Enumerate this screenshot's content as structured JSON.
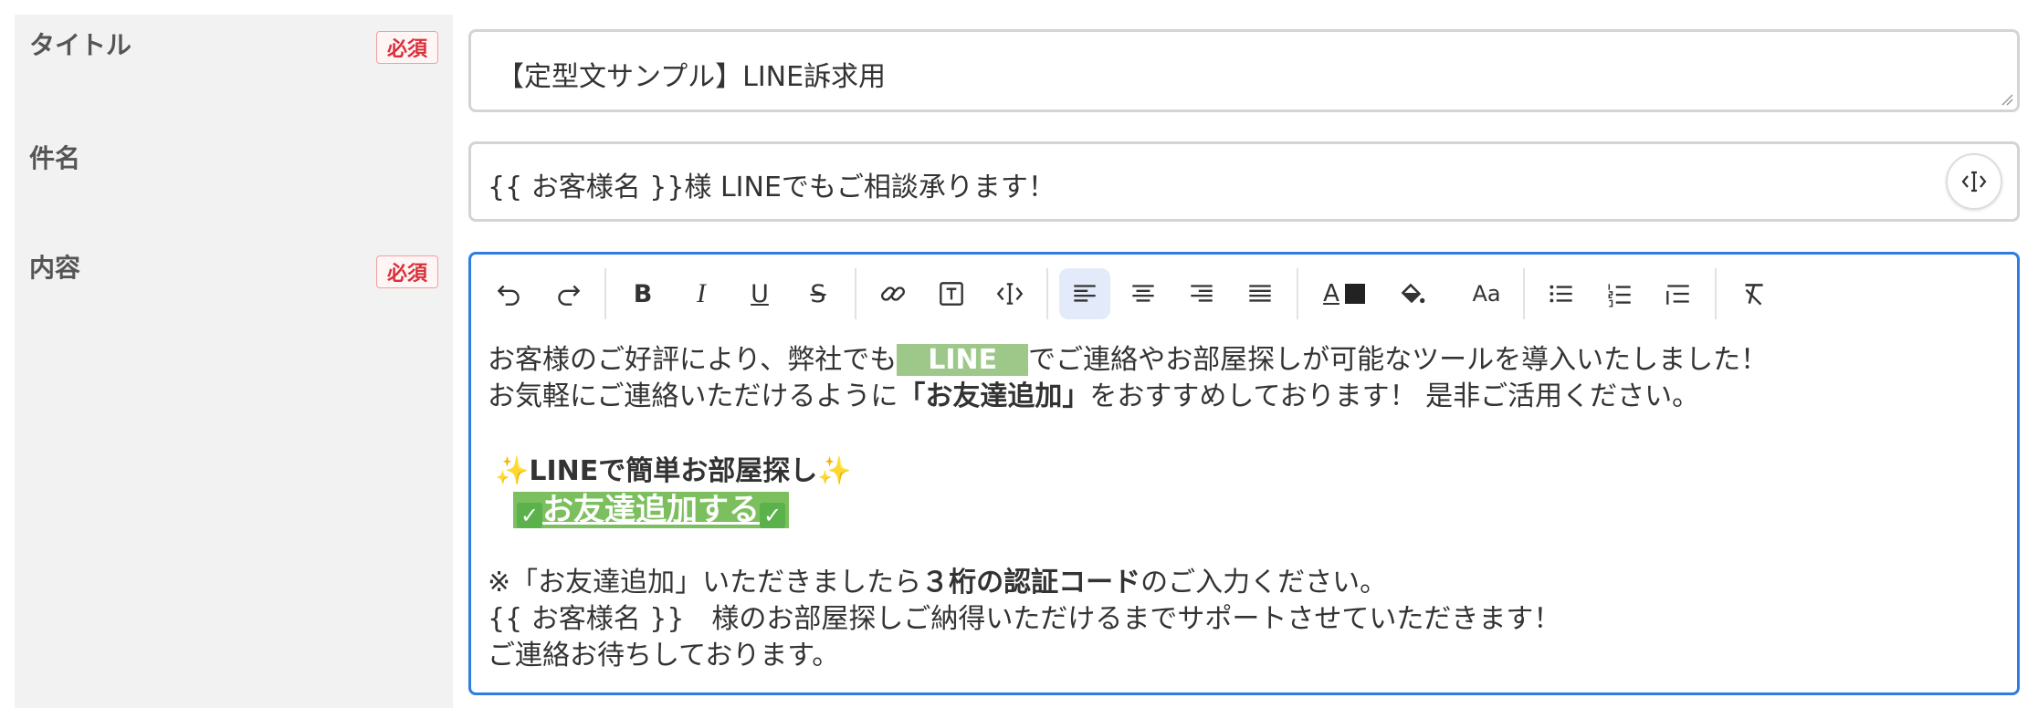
{
  "colors": {
    "label_bg": "#f2f2f2",
    "required": "#d9303a",
    "focus_border": "#2e7ee0",
    "line_highlight": "#9dc88a",
    "button_bg": "#7cbf5e"
  },
  "fields": {
    "title": {
      "label": "タイトル",
      "required_badge": "必須",
      "value": "【定型文サンプル】LINE訴求用"
    },
    "subject": {
      "label": "件名",
      "value": "{{ お客様名 }}様 LINEでもご相談承ります！",
      "variable_button_icon": "variable-insert-icon"
    },
    "content": {
      "label": "内容",
      "required_badge": "必須"
    }
  },
  "toolbar": {
    "items": [
      "undo-icon",
      "redo-icon",
      "bold-icon",
      "italic-icon",
      "underline-icon",
      "strikethrough-icon",
      "link-icon",
      "text-box-icon",
      "variable-insert-icon",
      "align-left-icon",
      "align-center-icon",
      "align-right-icon",
      "align-justify-icon",
      "font-color-icon",
      "highlight-color-icon",
      "font-size-icon",
      "bulleted-list-icon",
      "numbered-list-icon",
      "indent-list-icon",
      "clear-format-icon"
    ],
    "bold_glyph": "B",
    "italic_glyph": "I",
    "underline_glyph": "U",
    "strike_glyph": "S",
    "font_color_glyph": "A",
    "font_size_glyph": "Aa"
  },
  "content": {
    "line1_pre": "お客様のご好評により、弊社でも",
    "line1_highlight": "LINE",
    "line1_post": "でご連絡やお部屋探しが可能なツールを導入いたしました！",
    "line2_pre": " お気軽にご連絡いただけるように",
    "line2_bold": "「お友達追加」",
    "line2_post": "をおすすめしております！ 是非ご活用ください。",
    "line3_sparkle": "✨",
    "line3_bold": "LINEで簡単お部屋探し",
    "line4_check": "✓",
    "line4_button": "お友達追加する",
    "line5_pre": " ※「お友達追加」いただきましたら",
    "line5_bold": "３桁の認証コード",
    "line5_post": "のご入力ください。",
    "line6": " {{ お客様名 }}　様のお部屋探しご納得いただけるまでサポートさせていただきます！",
    "line7": "ご連絡お待ちしております。"
  }
}
